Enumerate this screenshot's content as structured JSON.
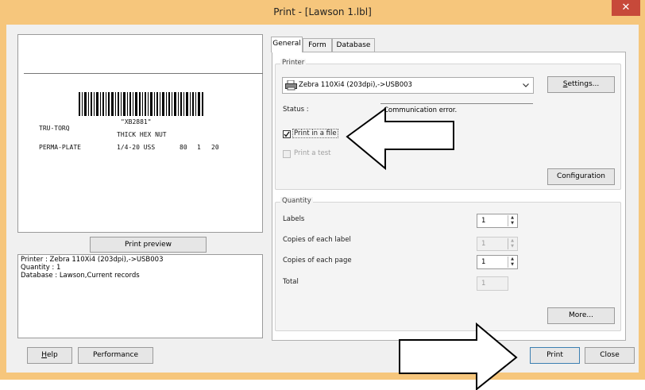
{
  "window": {
    "title": "Print - [Lawson 1.lbl]",
    "close_glyph": "✕"
  },
  "label_preview": {
    "company": "TRU-TORQ",
    "barcode_text": "\"XB2881\"",
    "product": "THICK HEX NUT",
    "plating": "PERMA-PLATE",
    "size": "1/4-20 USS",
    "col_a": "80",
    "col_b": "1",
    "col_c": "20"
  },
  "left": {
    "print_preview_label": "Print preview",
    "info_lines": [
      "Printer : Zebra 110Xi4 (203dpi),->USB003",
      "Quantity : 1",
      "Database : Lawson,Current records"
    ]
  },
  "tabs": [
    "General",
    "Form",
    "Database"
  ],
  "printer_group": {
    "title": "Printer",
    "selected_printer": "Zebra 110Xi4 (203dpi),->USB003",
    "settings_label": "Settings...",
    "settings_underline": "S",
    "settings_rest": "ettings...",
    "status_label": "Status :",
    "status_value": "Communication error.",
    "print_in_file": {
      "label": "Print in a file",
      "checked": true
    },
    "print_test": {
      "label": "Print a test",
      "checked": false,
      "enabled": false
    },
    "configuration_label": "Configuration"
  },
  "quantity_group": {
    "title": "Quantity",
    "rows": [
      {
        "label": "Labels",
        "value": "1",
        "enabled": true
      },
      {
        "label": "Copies of each label",
        "value": "1",
        "enabled": false
      },
      {
        "label": "Copies of each page",
        "value": "1",
        "enabled": true
      },
      {
        "label": "Total",
        "value": "1",
        "enabled": false
      }
    ],
    "more_label": "More..."
  },
  "footer": {
    "help_label": "Help",
    "help_underline": "H",
    "help_rest": "elp",
    "performance_label": "Performance",
    "print_label": "Print",
    "close_label": "Close"
  },
  "colors": {
    "title_bar": "#f6c67c",
    "close_button": "#c7493a",
    "dialog_bg": "#f0f0f0",
    "focus_border": "#3c7fb1"
  },
  "icons": [
    "printer-icon",
    "chevron-down-icon",
    "checkmark-icon",
    "spin-up-icon",
    "spin-down-icon"
  ]
}
